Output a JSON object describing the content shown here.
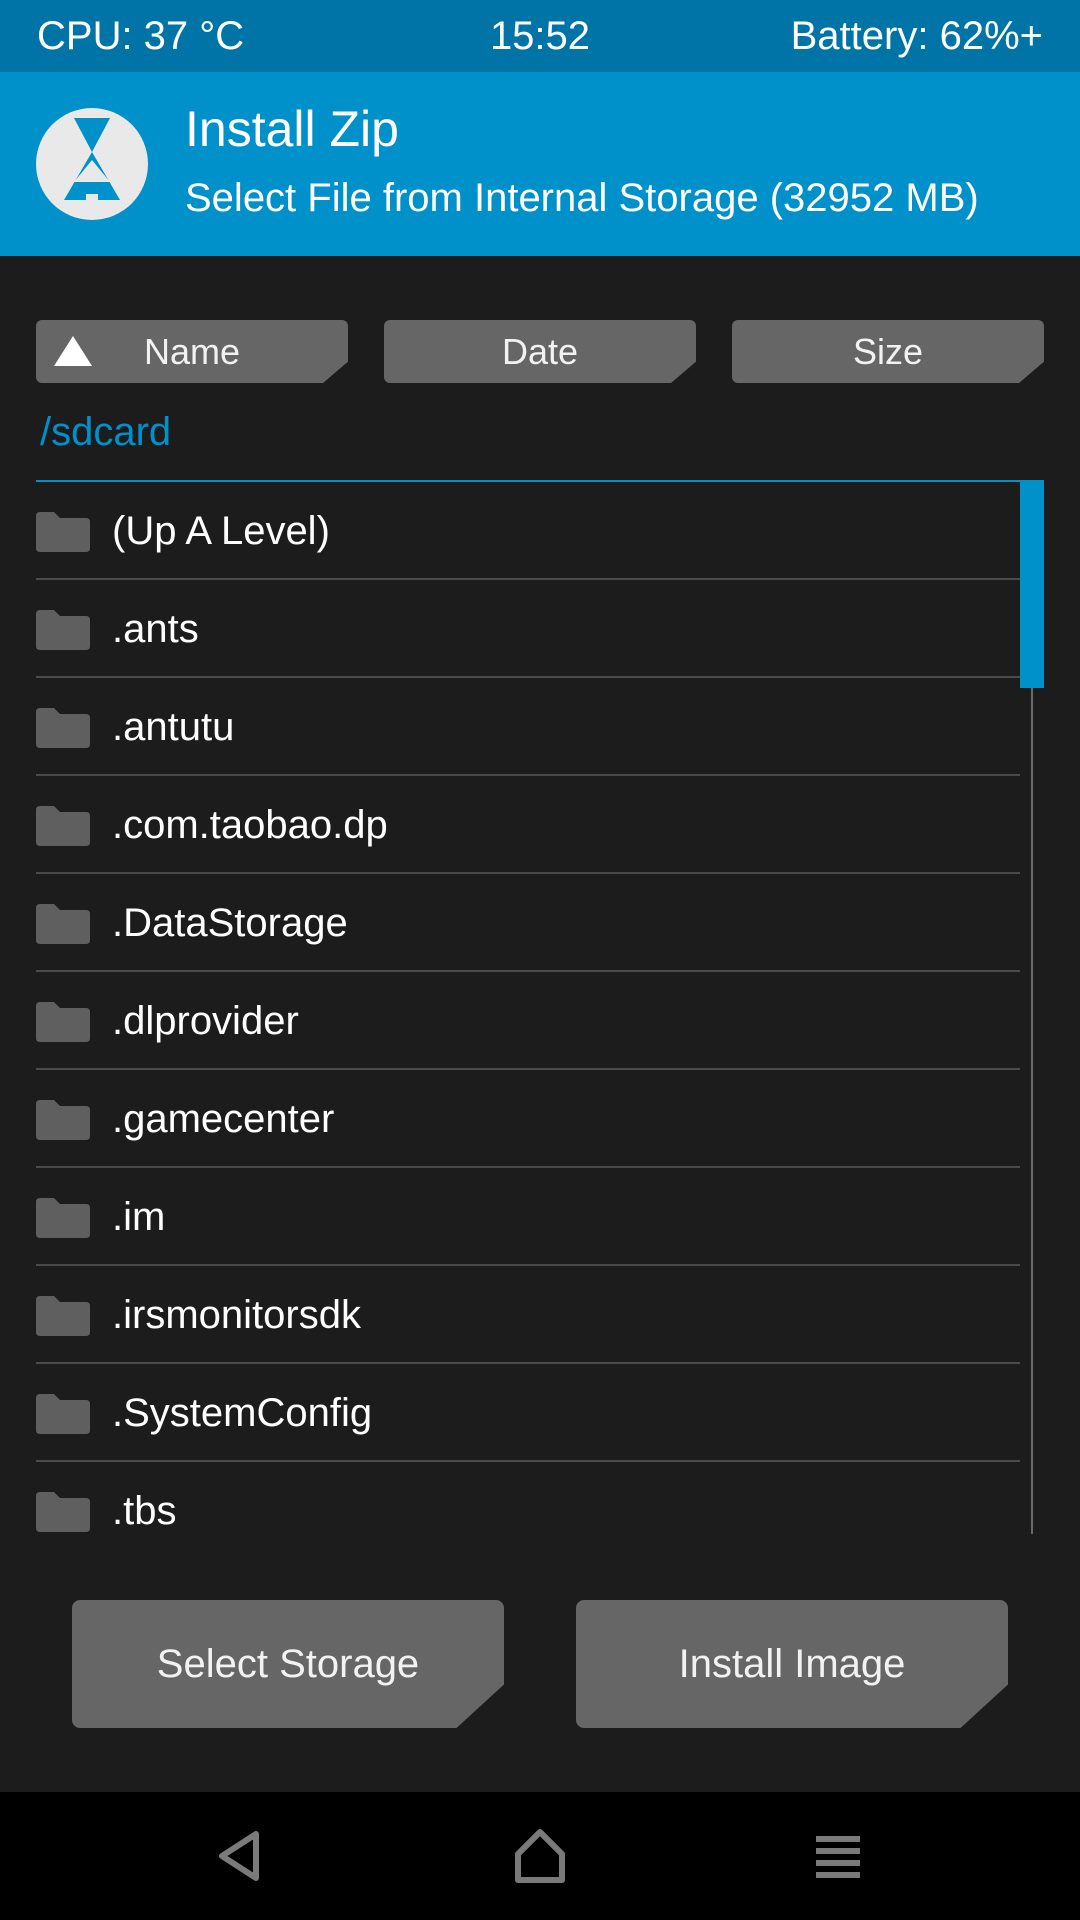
{
  "status_bar": {
    "cpu": "CPU: 37 °C",
    "time": "15:52",
    "battery": "Battery: 62%+"
  },
  "header": {
    "title": "Install Zip",
    "subtitle": "Select File from Internal Storage (32952 MB)",
    "logo_icon": "twrp-logo-icon"
  },
  "sort": {
    "name_label": "Name",
    "date_label": "Date",
    "size_label": "Size",
    "active": "Name",
    "direction_icon": "triangle-up-icon"
  },
  "path": "/sdcard",
  "files": [
    "(Up A Level)",
    ".ants",
    ".antutu",
    ".com.taobao.dp",
    ".DataStorage",
    ".dlprovider",
    ".gamecenter",
    ".im",
    ".irsmonitorsdk",
    ".SystemConfig",
    ".tbs"
  ],
  "actions": {
    "select_storage": "Select Storage",
    "install_image": "Install Image"
  },
  "nav": {
    "back_icon": "back-triangle-icon",
    "home_icon": "home-icon",
    "menu_icon": "menu-lines-icon"
  },
  "colors": {
    "accent": "#0090ca",
    "status_bar": "#0074a6",
    "background": "#1c1c1c",
    "button": "#666666",
    "divider": "#4a4a4a"
  }
}
